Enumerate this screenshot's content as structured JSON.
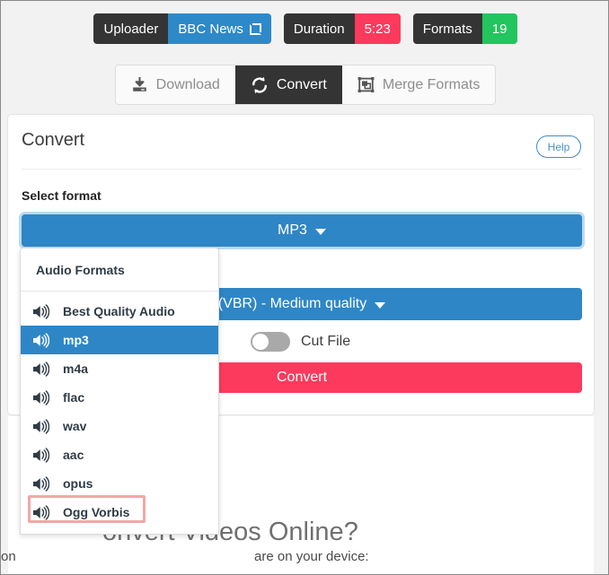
{
  "meta_badges": [
    {
      "key": "Uploader",
      "value": "BBC News",
      "value_color": "#2e89c9",
      "has_external_link_icon": true
    },
    {
      "key": "Duration",
      "value": "5:23",
      "value_color": "#fb3a5d",
      "has_external_link_icon": false
    },
    {
      "key": "Formats",
      "value": "19",
      "value_color": "#22c55e",
      "has_external_link_icon": false
    }
  ],
  "tabs": [
    {
      "label": "Download",
      "icon": "download-icon",
      "active": false
    },
    {
      "label": "Convert",
      "icon": "convert-refresh-icon",
      "active": true
    },
    {
      "label": "Merge Formats",
      "icon": "merge-formats-icon",
      "active": false
    }
  ],
  "card": {
    "title": "Convert",
    "help_label": "Help",
    "select_format_label": "Select format",
    "format_value": "MP3",
    "quality_value": "(VBR) - Medium quality",
    "cut_file_label": "Cut File",
    "cut_file_enabled": false,
    "convert_button_label": "Convert"
  },
  "dropdown": {
    "header": "Audio Formats",
    "items": [
      {
        "label": "Best Quality Audio",
        "icon": "speaker-icon",
        "selected": false,
        "outlined": false
      },
      {
        "label": "mp3",
        "icon": "speaker-icon",
        "selected": true,
        "outlined": false
      },
      {
        "label": "m4a",
        "icon": "speaker-icon",
        "selected": false,
        "outlined": false
      },
      {
        "label": "flac",
        "icon": "speaker-icon",
        "selected": false,
        "outlined": false
      },
      {
        "label": "wav",
        "icon": "speaker-icon",
        "selected": false,
        "outlined": false
      },
      {
        "label": "aac",
        "icon": "speaker-icon",
        "selected": false,
        "outlined": false
      },
      {
        "label": "opus",
        "icon": "speaker-icon",
        "selected": false,
        "outlined": false
      },
      {
        "label": "Ogg Vorbis",
        "icon": "speaker-icon",
        "selected": false,
        "outlined": true
      }
    ]
  },
  "background_page": {
    "heading": "onvert Videos Online?",
    "body_left": "on",
    "body_right": "are on your device:"
  },
  "colors": {
    "accent_blue": "#2e86c6",
    "accent_pink": "#fb3a5d",
    "accent_green": "#22c55e",
    "dark": "#343434",
    "highlight_outline": "#f4a6a6"
  }
}
